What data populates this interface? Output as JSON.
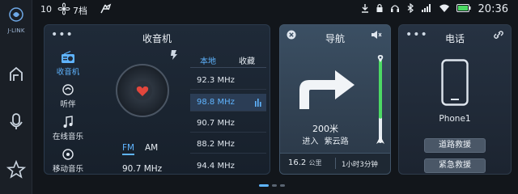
{
  "status_bar": {
    "temperature": "10",
    "fan_icon": "fan-icon",
    "fan_level": "7档",
    "auto_icon": "auto-climate-icon",
    "time": "20:36",
    "right_icons": [
      "download-icon",
      "lock-icon",
      "headset-icon",
      "bluetooth-icon",
      "signal-4g-icon",
      "wifi-icon",
      "battery-icon"
    ]
  },
  "rail": {
    "logo_text": "J-LINK",
    "items": [
      "home-icon",
      "voice-icon",
      "favorite-icon"
    ]
  },
  "radio": {
    "title": "收音机",
    "sidebar": [
      {
        "label": "收音机",
        "icon": "radio-icon",
        "active": true
      },
      {
        "label": "听伴",
        "icon": "listen-icon",
        "active": false
      },
      {
        "label": "在线音乐",
        "icon": "music-note-icon",
        "active": false
      },
      {
        "label": "移动音乐",
        "icon": "mobile-music-icon",
        "active": false
      }
    ],
    "band_fm": "FM",
    "band_am": "AM",
    "current_freq": "90.7 MHz",
    "tab_local": "本地",
    "tab_favorites": "收藏",
    "stations": [
      {
        "freq": "92.3 MHz",
        "active": false
      },
      {
        "freq": "98.8 MHz",
        "active": true
      },
      {
        "freq": "90.7 MHz",
        "active": false
      },
      {
        "freq": "88.2 MHz",
        "active": false
      },
      {
        "freq": "94.4 MHz",
        "active": false
      }
    ]
  },
  "navigation": {
    "title": "导航",
    "distance": "200米",
    "enter_label": "进入",
    "road_name": "紫云路",
    "remaining_km": "16.2",
    "km_unit": "公里",
    "eta": "1小时3分钟",
    "progress": 0.28
  },
  "phone": {
    "title": "电话",
    "device_name": "Phone1",
    "roadside_assist": "道路救援",
    "emergency": "紧急救援"
  },
  "pager": {
    "pages": 3,
    "current": 1
  },
  "colors": {
    "accent": "#5fb4ff",
    "progress": "#4cd964"
  }
}
